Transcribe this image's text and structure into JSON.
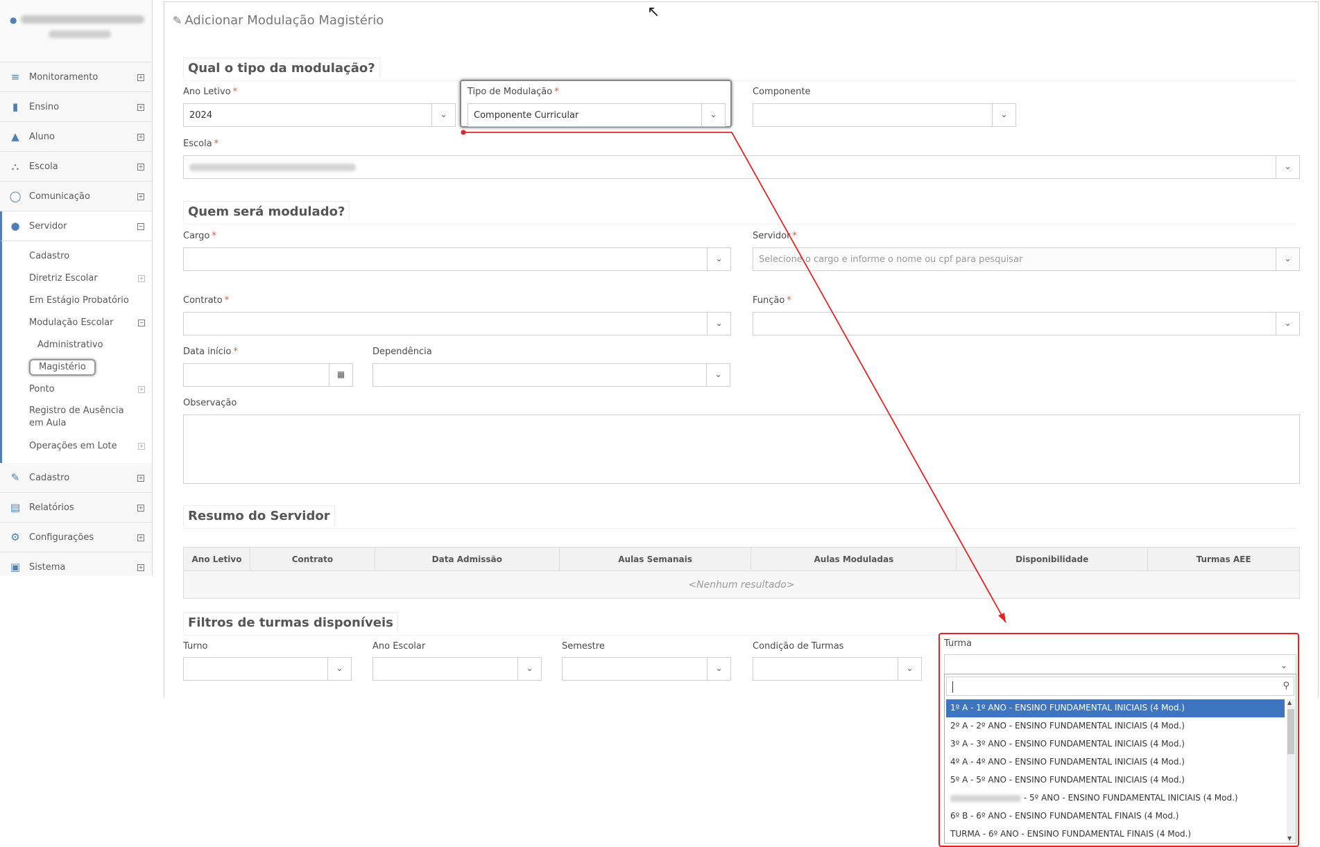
{
  "sidebar": {
    "items": [
      {
        "label": "Monitoramento",
        "icon": "sliders-icon"
      },
      {
        "label": "Ensino",
        "icon": "book-icon"
      },
      {
        "label": "Aluno",
        "icon": "graduation-cap-icon"
      },
      {
        "label": "Escola",
        "icon": "bank-icon"
      },
      {
        "label": "Comunicação",
        "icon": "chat-icon"
      },
      {
        "label": "Servidor",
        "icon": "user-icon"
      }
    ],
    "servidor_sub": {
      "cadastro": "Cadastro",
      "diretriz": "Diretriz Escolar",
      "estagio": "Em Estágio Probatório",
      "modulacao": "Modulação Escolar",
      "administrativo": "Administrativo",
      "magisterio": "Magistério",
      "ponto": "Ponto",
      "registro": "Registro de Ausência em Aula",
      "operacoes": "Operações em Lote"
    },
    "bottom_items": [
      {
        "label": "Cadastro",
        "icon": "edit-icon"
      },
      {
        "label": "Relatórios",
        "icon": "document-icon"
      },
      {
        "label": "Configurações",
        "icon": "gear-icon"
      },
      {
        "label": "Sistema",
        "icon": "monitor-icon"
      }
    ]
  },
  "page": {
    "title": "Adicionar Modulação Magistério"
  },
  "sections": {
    "tipo": "Qual o tipo da modulação?",
    "quem": "Quem será modulado?",
    "resumo": "Resumo do Servidor",
    "filtros": "Filtros de turmas disponíveis"
  },
  "form": {
    "ano_letivo": {
      "label": "Ano Letivo",
      "value": "2024"
    },
    "tipo_modulacao": {
      "label": "Tipo de Modulação",
      "value": "Componente Curricular"
    },
    "componente": {
      "label": "Componente"
    },
    "escola": {
      "label": "Escola"
    },
    "cargo": {
      "label": "Cargo"
    },
    "servidor": {
      "label": "Servidor",
      "placeholder": "Selecione o cargo e informe o nome ou cpf para pesquisar"
    },
    "contrato": {
      "label": "Contrato"
    },
    "funcao": {
      "label": "Função"
    },
    "data_inicio": {
      "label": "Data início"
    },
    "dependencia": {
      "label": "Dependência"
    },
    "observacao": {
      "label": "Observação"
    },
    "required_mark": "*"
  },
  "table": {
    "headers": [
      "Ano Letivo",
      "Contrato",
      "Data Admissão",
      "Aulas Semanais",
      "Aulas Moduladas",
      "Disponibilidade",
      "Turmas AEE"
    ],
    "empty": "<Nenhum resultado>"
  },
  "filters": {
    "turno": "Turno",
    "ano_escolar": "Ano Escolar",
    "semestre": "Semestre",
    "condicao": "Condição de Turmas",
    "turma": "Turma"
  },
  "turma_options": [
    "1º A - 1º ANO - ENSINO FUNDAMENTAL INICIAIS (4 Mod.)",
    "2º A - 2º ANO - ENSINO FUNDAMENTAL INICIAIS (4 Mod.)",
    "3º A - 3º ANO - ENSINO FUNDAMENTAL INICIAIS (4 Mod.)",
    "4º A - 4º ANO - ENSINO FUNDAMENTAL INICIAIS (4 Mod.)",
    "5º A - 5º ANO - ENSINO FUNDAMENTAL INICIAIS (4 Mod.)",
    " - 5º ANO - ENSINO FUNDAMENTAL INICIAIS (4 Mod.)",
    "6º B - 6º ANO - ENSINO FUNDAMENTAL FINAIS (4 Mod.)",
    "TURMA - 6º ANO - ENSINO FUNDAMENTAL FINAIS (4 Mod.)"
  ],
  "colors": {
    "accent": "#4f80b5",
    "selected": "#3e75c0",
    "annotation": "#e02424"
  }
}
